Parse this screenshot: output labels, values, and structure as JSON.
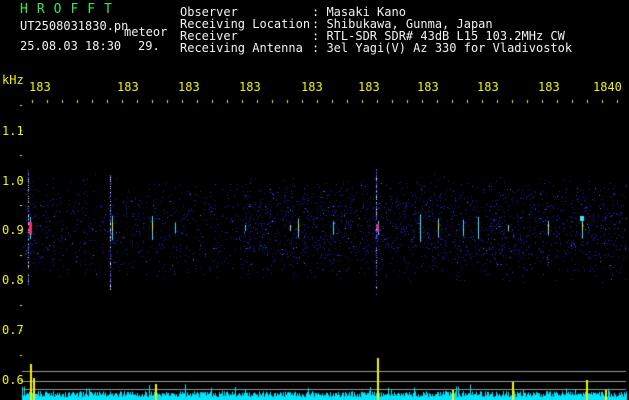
{
  "header": {
    "station": "HROFFT",
    "filename": "UT2508031830.pn",
    "filename_suffix": "meteor",
    "datetime": "25.08.03 18:30",
    "count": "29.",
    "fields": [
      {
        "label": "Observer",
        "value": ": Masaki Kano"
      },
      {
        "label": "Receiving Location",
        "value": ": Shibukawa, Gunma, Japan"
      },
      {
        "label": "Receiver",
        "value": ": RTL-SDR SDR# 43dB L15 103.2MHz CW"
      },
      {
        "label": "Receiving Antenna",
        "value": ": 3el Yagi(V) Az 330 for Vladivostok"
      }
    ]
  },
  "axes": {
    "y_unit": "kHz",
    "y_ticks": [
      "1.1",
      "1.0",
      "0.9",
      "0.8",
      "0.7",
      "0.6"
    ],
    "x_ticks": [
      "183",
      "183",
      "183",
      "183",
      "183",
      "183",
      "183",
      "183",
      "183",
      "1840"
    ]
  },
  "colors": {
    "title": "#2fe85a",
    "text": "#f2f2f2",
    "axis": "#f2f200",
    "noise": "#1d30d8",
    "echo": "#3fe0ff",
    "hot": "#ff2a6a",
    "baseline": "#00e5ff"
  }
}
